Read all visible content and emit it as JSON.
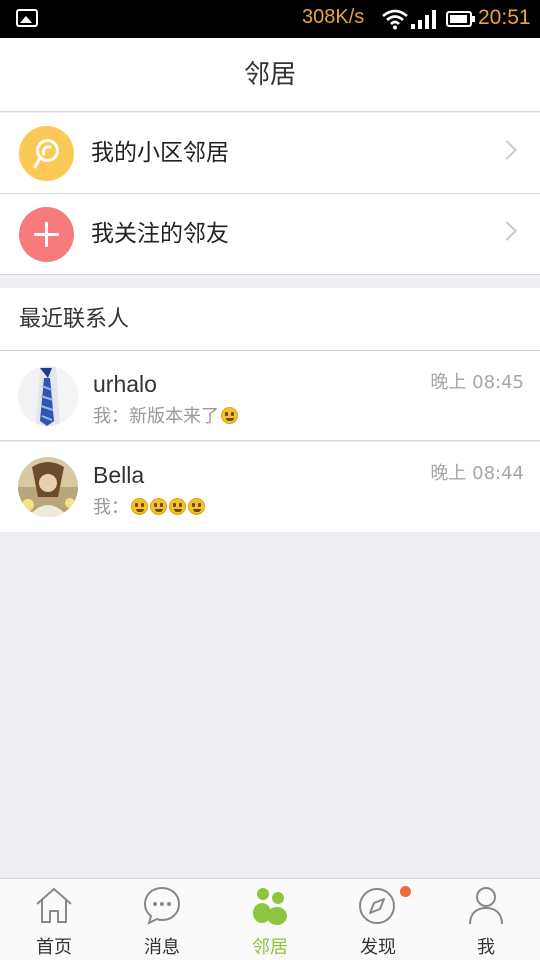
{
  "status_bar": {
    "speed": "308K/s",
    "time": "20:51",
    "icons": [
      "gallery-icon",
      "wifi-icon",
      "signal-icon",
      "battery-icon"
    ]
  },
  "header": {
    "title": "邻居"
  },
  "menu": [
    {
      "label": "我的小区邻居",
      "icon": "community-icon",
      "color": "#fbc956"
    },
    {
      "label": "我关注的邻友",
      "icon": "plus-icon",
      "color": "#f77a7c"
    }
  ],
  "recent_section": {
    "title": "最近联系人"
  },
  "contacts": [
    {
      "name": "urhalo",
      "preview": "我：新版本来了",
      "emoji_count": 1,
      "time": "晚上 08:45"
    },
    {
      "name": "Bella",
      "preview": "我：",
      "emoji_count": 4,
      "time": "晚上 08:44"
    }
  ],
  "tabs": [
    {
      "label": "首页",
      "icon": "home-icon",
      "active": false
    },
    {
      "label": "消息",
      "icon": "chat-bubble-icon",
      "active": false
    },
    {
      "label": "邻居",
      "icon": "neighbors-icon",
      "active": true
    },
    {
      "label": "发现",
      "icon": "compass-icon",
      "active": false,
      "badge": true
    },
    {
      "label": "我",
      "icon": "person-icon",
      "active": false
    }
  ],
  "colors": {
    "accent": "#8cc63f",
    "status_text": "#e8a33c",
    "badge": "#f06a3c"
  }
}
